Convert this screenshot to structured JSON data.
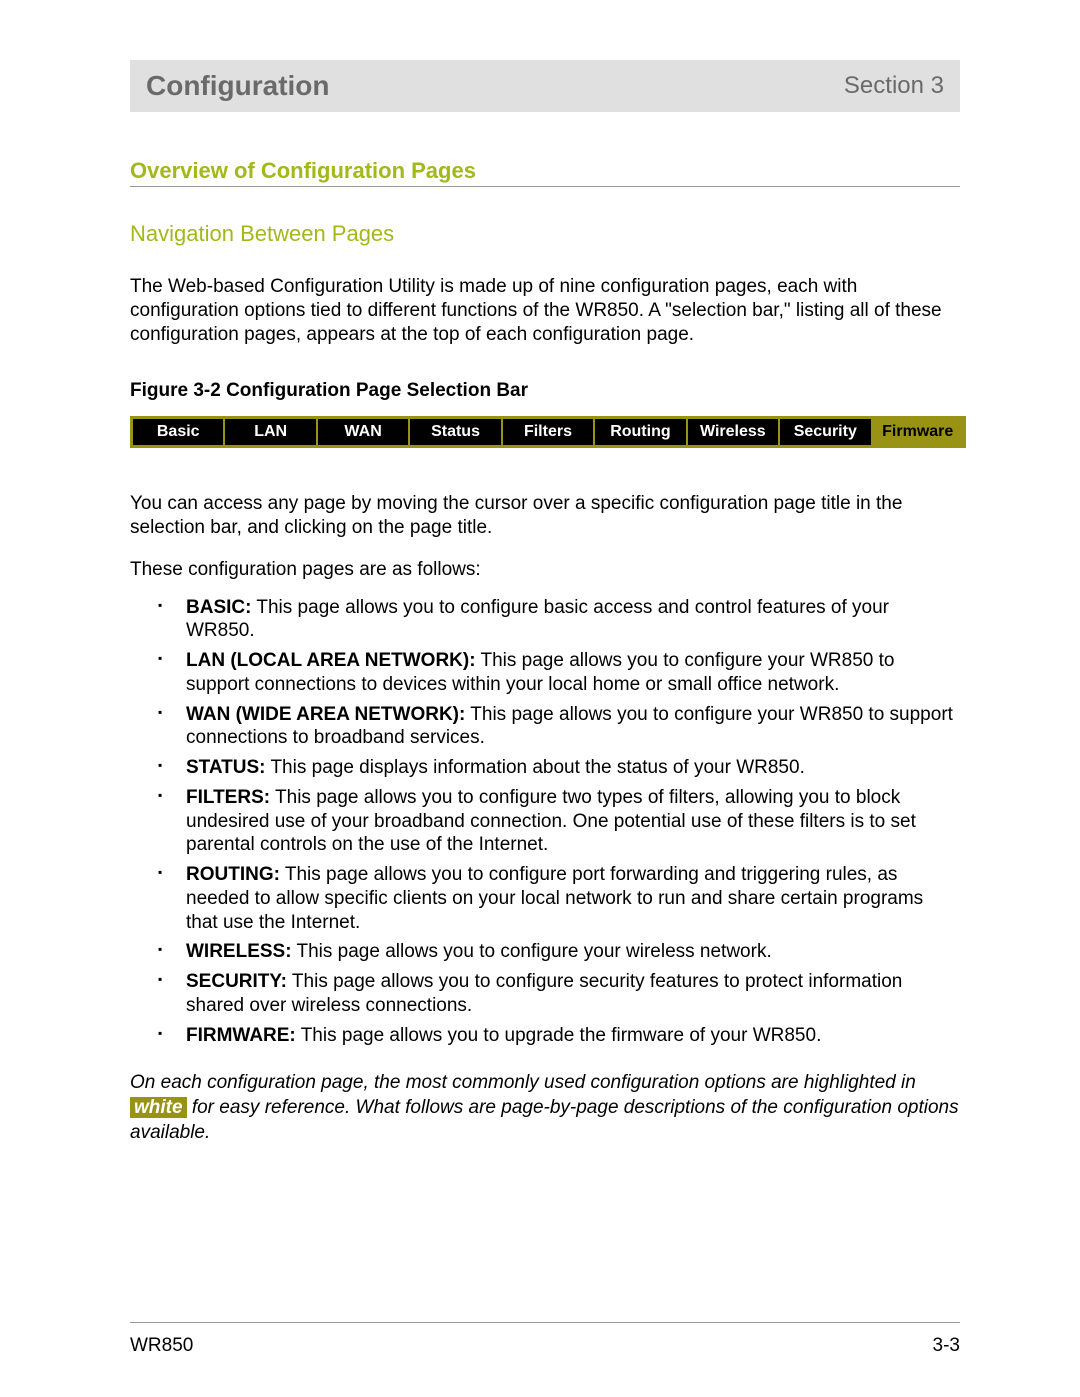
{
  "header": {
    "title": "Configuration",
    "section": "Section 3"
  },
  "section_heading": "Overview of Configuration Pages",
  "sub_heading": "Navigation Between Pages",
  "intro_paragraph": "The Web-based Configuration Utility is made up of nine configuration pages, each with configuration options tied to different functions of the WR850.  A \"selection bar,\" listing all of these configuration pages, appears at the top of each configuration page.",
  "figure_caption": "Figure 3-2  Configuration Page Selection Bar",
  "tabs": [
    "Basic",
    "LAN",
    "WAN",
    "Status",
    "Filters",
    "Routing",
    "Wireless",
    "Security",
    "Firmware"
  ],
  "access_paragraph": "You can access any page by moving the cursor over a specific configuration page title in the selection bar, and clicking on the page title.",
  "follows_paragraph": "These configuration pages are as follows:",
  "items": [
    {
      "term": "BASIC:",
      "desc": " This page allows you to configure basic access and control features of your WR850."
    },
    {
      "term": "LAN (LOCAL AREA NETWORK):",
      "desc": " This page allows you to configure your WR850 to support connections to devices within your local home or small office network."
    },
    {
      "term": "WAN (WIDE AREA NETWORK):",
      "desc": " This page allows you to configure your WR850 to support connections to broadband services."
    },
    {
      "term": "STATUS:",
      "desc": " This page displays information about the status of your WR850."
    },
    {
      "term": "FILTERS:",
      "desc": " This page allows you to configure two types of filters, allowing you to block undesired use of your broadband connection. One potential use of these filters is to set parental controls on the use of the Internet."
    },
    {
      "term": "ROUTING:",
      "desc": " This page allows you to configure port forwarding and triggering rules, as needed to allow specific clients on your local network to run and share certain programs that use the Internet."
    },
    {
      "term": "WIRELESS:",
      "desc": " This page allows you to configure your wireless network."
    },
    {
      "term": "SECURITY:",
      "desc": " This page allows you to configure security features to protect information shared over wireless connections."
    },
    {
      "term": "FIRMWARE:",
      "desc": " This page allows you to upgrade the firmware of your WR850."
    }
  ],
  "note_prefix": "On each configuration page, the most commonly used configuration options are highlighted in ",
  "note_highlight": "white",
  "note_suffix": " for easy reference.  What follows are page-by-page descriptions of the configuration options available.",
  "footer": {
    "left": "WR850",
    "right": "3-3"
  }
}
